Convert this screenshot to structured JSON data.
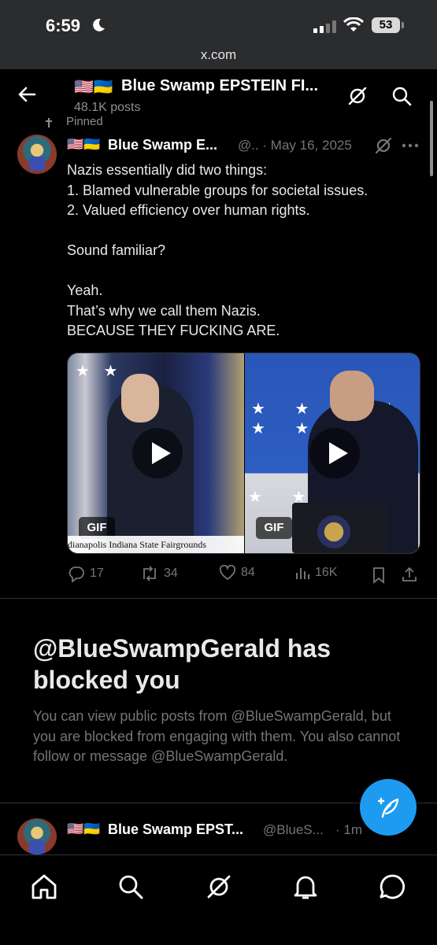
{
  "status_bar": {
    "time": "6:59",
    "battery": "53",
    "url": "x.com"
  },
  "header": {
    "flags": "🇺🇸🇺🇦",
    "title": "Blue Swamp EPSTEIN FI...",
    "post_count": "48.1K posts"
  },
  "pinned_post": {
    "pinned_label": "Pinned",
    "flags": "🇺🇸🇺🇦",
    "author_name": "Blue Swamp E...",
    "meta": "@.. · May 16, 2025",
    "text": "Nazis essentially did two things:\n1. Blamed vulnerable groups for societal issues.\n2. Valued efficiency over human rights.\n\nSound familiar?\n\nYeah.\nThat’s why we call them Nazis.\nBECAUSE THEY FUCKING ARE.",
    "media": [
      {
        "badge": "GIF",
        "caption": "dianapolis Indiana State Fairgrounds"
      },
      {
        "badge": "GIF",
        "caption": ""
      }
    ],
    "stats": {
      "replies": "17",
      "reposts": "34",
      "likes": "84",
      "views": "16K"
    }
  },
  "blocked_notice": {
    "title": "@BlueSwampGerald has blocked you",
    "description": "You can view public posts from @BlueSwampGerald, but you are blocked from engaging with them. You also cannot follow or message @BlueSwampGerald."
  },
  "next_post": {
    "flags": "🇺🇸🇺🇦",
    "author_name": "Blue Swamp EPST...",
    "handle": "@BlueS...",
    "time": "· 1m"
  },
  "colors": {
    "accent": "#1d9bf0",
    "background": "#000000",
    "muted": "#71767b"
  },
  "icons": [
    "back-arrow-icon",
    "grok-icon",
    "search-icon",
    "more-icon",
    "reply-icon",
    "repost-icon",
    "like-icon",
    "views-icon",
    "bookmark-icon",
    "share-icon",
    "compose-icon",
    "home-icon",
    "explore-icon",
    "notifications-icon",
    "messages-icon"
  ]
}
